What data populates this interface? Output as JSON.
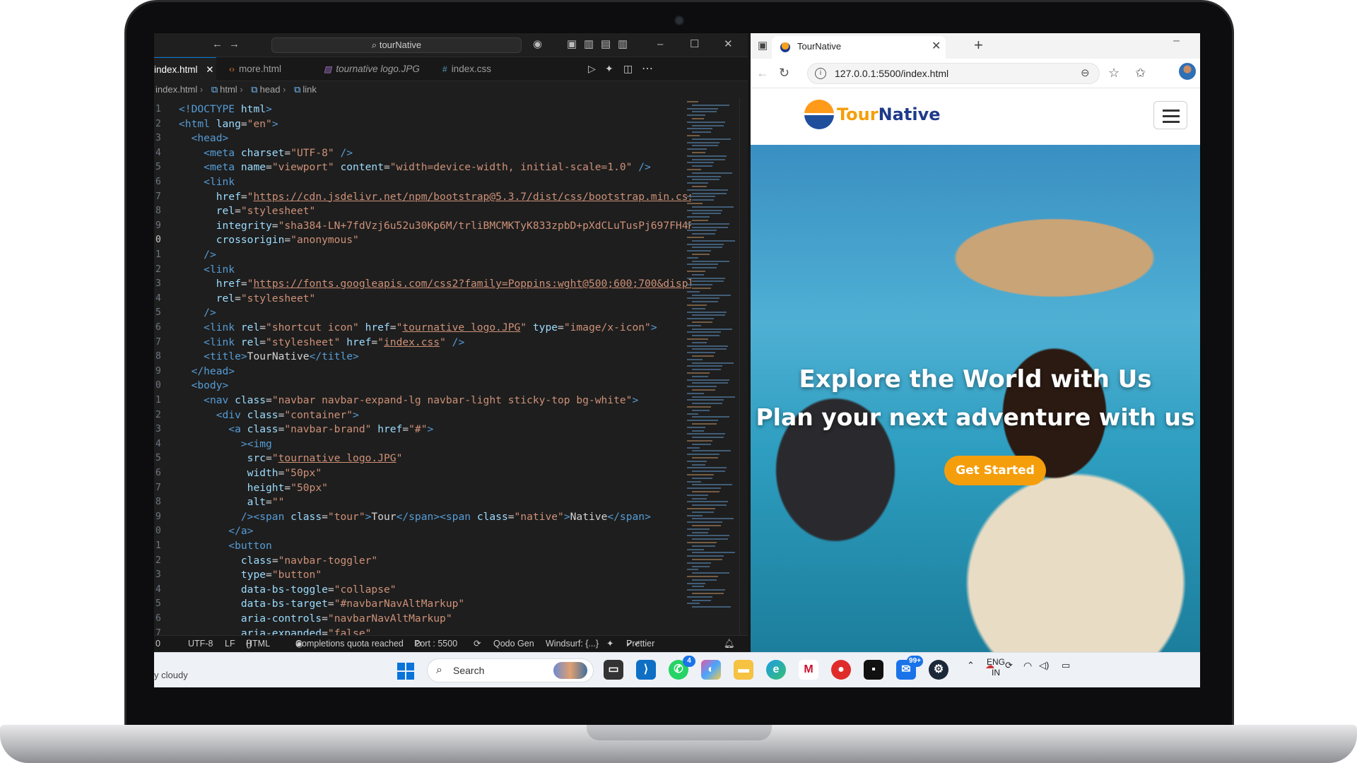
{
  "vscode": {
    "search_text": "tourNative",
    "tabs": [
      {
        "label": "index.html",
        "icon": "html-icon",
        "close": "✕"
      },
      {
        "label": "more.html",
        "icon": "html-icon"
      },
      {
        "label": "tournative logo.JPG",
        "icon": "image-icon"
      },
      {
        "label": "index.css",
        "icon": "css-icon"
      }
    ],
    "breadcrumb": [
      "index.html",
      "html",
      "head",
      "link"
    ],
    "line_numbers": [
      "1",
      "2",
      "3",
      "4",
      "5",
      "6",
      "7",
      "8",
      "9",
      "0",
      "1",
      "2",
      "3",
      "4",
      "5",
      "6",
      "7",
      "8",
      "9",
      "0",
      "1",
      "2",
      "3",
      "4",
      "5",
      "6",
      "7",
      "8",
      "9",
      "0",
      "1",
      "2",
      "3",
      "4",
      "5",
      "6",
      "7"
    ],
    "status": {
      "left": "0",
      "encoding": "UTF-8",
      "eol": "LF",
      "language": "HTML",
      "quota": "Completions quota reached",
      "port": "Port : 5500",
      "qodo": "Qodo Gen",
      "windsurf": "Windsurf: {...}",
      "prettier": "Prettier"
    }
  },
  "browser": {
    "tab_title": "TourNative",
    "tab_close": "✕",
    "new_tab": "+",
    "url": "127.0.0.1:5500/index.html",
    "site": {
      "brand_tour": "Tour",
      "brand_native": "Native",
      "hero_title": "Explore the World with Us",
      "hero_subtitle": "Plan your next adventure with us",
      "cta": "Get Started"
    }
  },
  "taskbar": {
    "weather": "y cloudy",
    "search_label": "Search",
    "whatsapp_badge": "4",
    "outlook_badge": "99+",
    "lang_top": "ENG",
    "lang_bottom": "IN"
  },
  "colors": {
    "accent": "#f59e0b",
    "brand_blue": "#1e3a8a",
    "vscode_bg": "#1e1e1e"
  }
}
